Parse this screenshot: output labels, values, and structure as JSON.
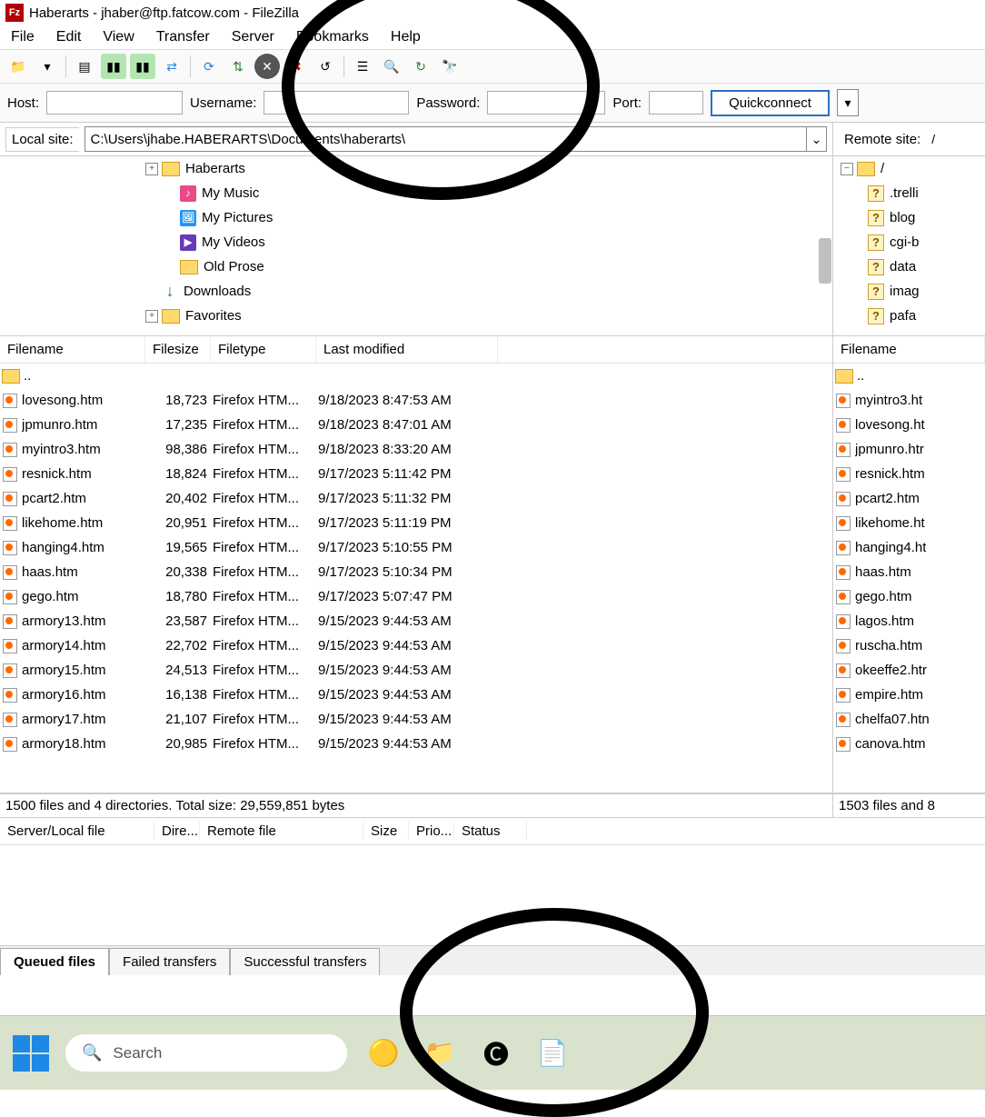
{
  "title": "Haberarts - jhaber@ftp.fatcow.com - FileZilla",
  "menu": [
    "File",
    "Edit",
    "View",
    "Transfer",
    "Server",
    "Bookmarks",
    "Help"
  ],
  "quickconnect": {
    "host_label": "Host:",
    "user_label": "Username:",
    "pass_label": "Password:",
    "port_label": "Port:",
    "button": "Quickconnect",
    "host": "",
    "user": "",
    "pass": "",
    "port": ""
  },
  "local_site": {
    "label": "Local site:",
    "path": "C:\\Users\\jhabe.HABERARTS\\Documents\\haberarts\\"
  },
  "remote_site": {
    "label": "Remote site:",
    "path": "/"
  },
  "local_tree": [
    {
      "name": "Haberarts",
      "icon": "folder",
      "exp": "+",
      "indent": 1
    },
    {
      "name": "My Music",
      "icon": "music",
      "indent": 2
    },
    {
      "name": "My Pictures",
      "icon": "pic",
      "indent": 2
    },
    {
      "name": "My Videos",
      "icon": "vid",
      "indent": 2
    },
    {
      "name": "Old Prose",
      "icon": "folder",
      "indent": 2
    },
    {
      "name": "Downloads",
      "icon": "dl",
      "indent": 1
    },
    {
      "name": "Favorites",
      "icon": "folder",
      "exp": "+",
      "indent": 1
    }
  ],
  "remote_tree": {
    "root": "/",
    "items": [
      ".trelli",
      "blog",
      "cgi-b",
      "data",
      "imag",
      "pafa"
    ]
  },
  "local_cols": {
    "fn": "Filename",
    "fs": "Filesize",
    "ft": "Filetype",
    "lm": "Last modified"
  },
  "local_files": [
    {
      "name": "..",
      "icon": "folder"
    },
    {
      "name": "lovesong.htm",
      "size": "18,723",
      "type": "Firefox HTM...",
      "mod": "9/18/2023 8:47:53 AM"
    },
    {
      "name": "jpmunro.htm",
      "size": "17,235",
      "type": "Firefox HTM...",
      "mod": "9/18/2023 8:47:01 AM"
    },
    {
      "name": "myintro3.htm",
      "size": "98,386",
      "type": "Firefox HTM...",
      "mod": "9/18/2023 8:33:20 AM"
    },
    {
      "name": "resnick.htm",
      "size": "18,824",
      "type": "Firefox HTM...",
      "mod": "9/17/2023 5:11:42 PM"
    },
    {
      "name": "pcart2.htm",
      "size": "20,402",
      "type": "Firefox HTM...",
      "mod": "9/17/2023 5:11:32 PM"
    },
    {
      "name": "likehome.htm",
      "size": "20,951",
      "type": "Firefox HTM...",
      "mod": "9/17/2023 5:11:19 PM"
    },
    {
      "name": "hanging4.htm",
      "size": "19,565",
      "type": "Firefox HTM...",
      "mod": "9/17/2023 5:10:55 PM"
    },
    {
      "name": "haas.htm",
      "size": "20,338",
      "type": "Firefox HTM...",
      "mod": "9/17/2023 5:10:34 PM"
    },
    {
      "name": "gego.htm",
      "size": "18,780",
      "type": "Firefox HTM...",
      "mod": "9/17/2023 5:07:47 PM"
    },
    {
      "name": "armory13.htm",
      "size": "23,587",
      "type": "Firefox HTM...",
      "mod": "9/15/2023 9:44:53 AM"
    },
    {
      "name": "armory14.htm",
      "size": "22,702",
      "type": "Firefox HTM...",
      "mod": "9/15/2023 9:44:53 AM"
    },
    {
      "name": "armory15.htm",
      "size": "24,513",
      "type": "Firefox HTM...",
      "mod": "9/15/2023 9:44:53 AM"
    },
    {
      "name": "armory16.htm",
      "size": "16,138",
      "type": "Firefox HTM...",
      "mod": "9/15/2023 9:44:53 AM"
    },
    {
      "name": "armory17.htm",
      "size": "21,107",
      "type": "Firefox HTM...",
      "mod": "9/15/2023 9:44:53 AM"
    },
    {
      "name": "armory18.htm",
      "size": "20,985",
      "type": "Firefox HTM...",
      "mod": "9/15/2023 9:44:53 AM"
    }
  ],
  "local_status": "1500 files and 4 directories. Total size: 29,559,851 bytes",
  "remote_cols": {
    "fn": "Filename"
  },
  "remote_files": [
    {
      "name": "..",
      "icon": "folder"
    },
    {
      "name": "myintro3.ht"
    },
    {
      "name": "lovesong.ht"
    },
    {
      "name": "jpmunro.htr"
    },
    {
      "name": "resnick.htm"
    },
    {
      "name": "pcart2.htm"
    },
    {
      "name": "likehome.ht"
    },
    {
      "name": "hanging4.ht"
    },
    {
      "name": "haas.htm"
    },
    {
      "name": "gego.htm"
    },
    {
      "name": "lagos.htm"
    },
    {
      "name": "ruscha.htm"
    },
    {
      "name": "okeeffe2.htr"
    },
    {
      "name": "empire.htm"
    },
    {
      "name": "chelfa07.htn"
    },
    {
      "name": "canova.htm"
    }
  ],
  "remote_status": "1503 files and 8",
  "queue_cols": [
    "Server/Local file",
    "Dire...",
    "Remote file",
    "Size",
    "Prio...",
    "Status"
  ],
  "tabs": [
    "Queued files",
    "Failed transfers",
    "Successful transfers"
  ],
  "taskbar": {
    "search_placeholder": "Search"
  }
}
